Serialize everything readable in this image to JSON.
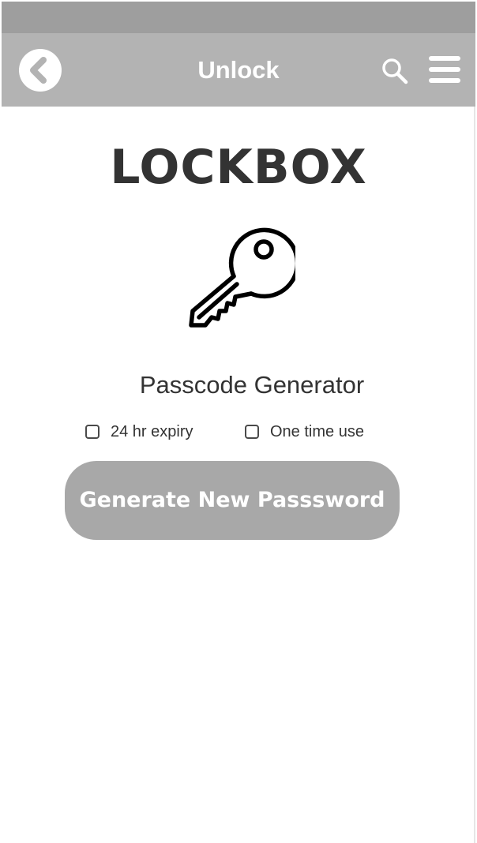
{
  "header": {
    "title": "Unlock",
    "back_icon": "chevron-left-icon",
    "search_icon": "search-icon",
    "menu_icon": "hamburger-menu-icon",
    "bar_color": "#b3b3b3",
    "status_color": "#9e9e9e"
  },
  "brand": {
    "name": "LOCKBOX",
    "illustration_icon": "key-icon"
  },
  "generator": {
    "heading": "Passcode Generator",
    "options": [
      {
        "label": "24 hr expiry",
        "checked": false
      },
      {
        "label": "One time use",
        "checked": false
      }
    ],
    "button_label": "Generate New Passsword",
    "button_color": "#a8a8a8"
  }
}
